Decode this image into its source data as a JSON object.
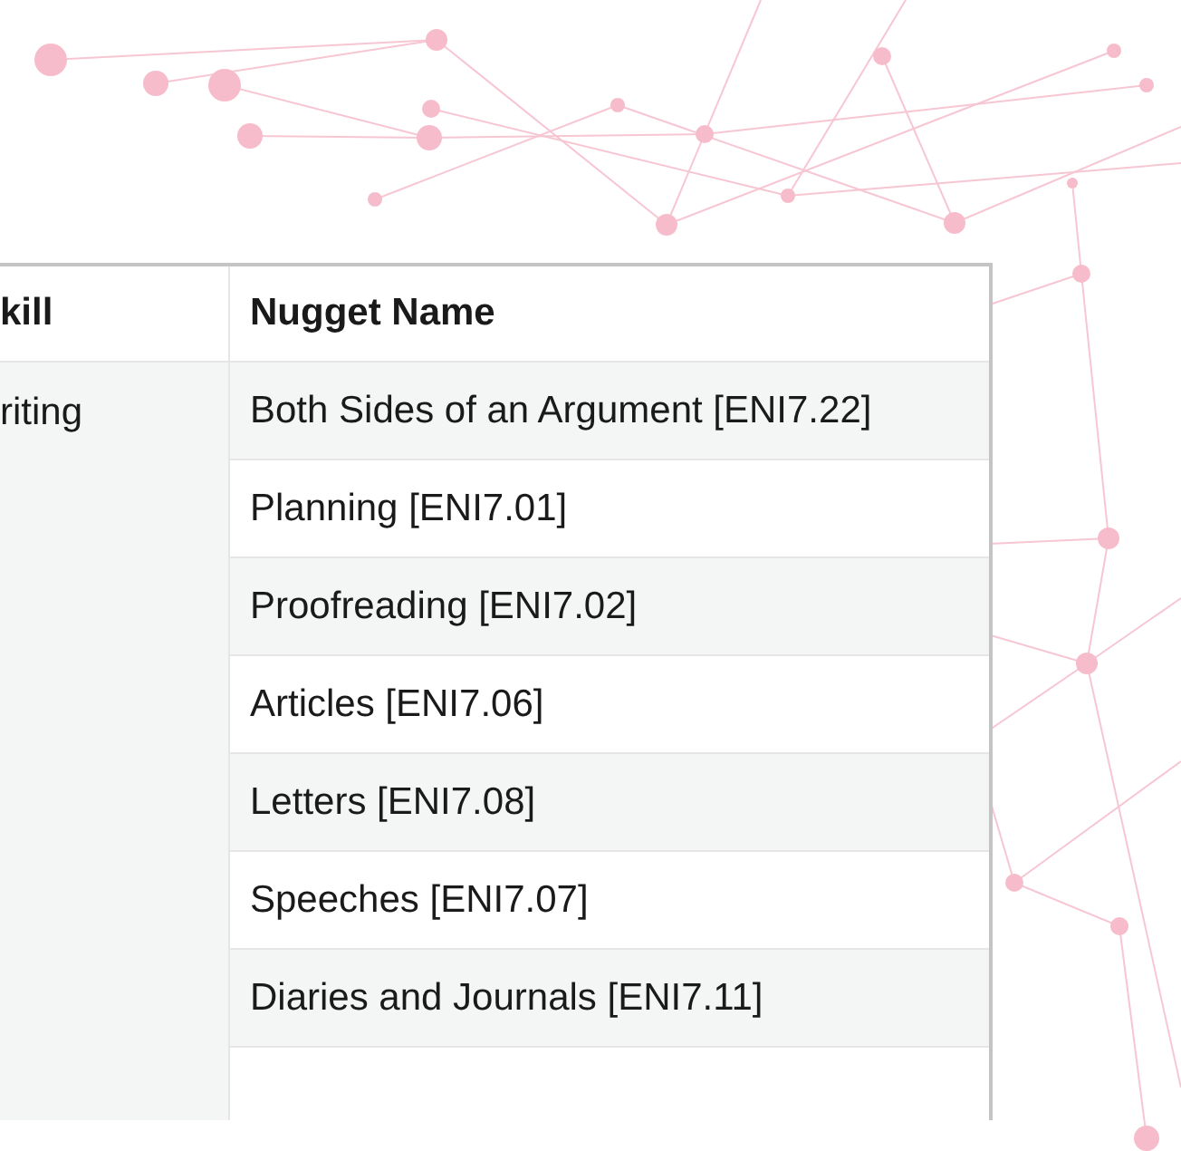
{
  "table": {
    "columns": [
      "kill",
      "Nugget Name"
    ],
    "skill": "riting",
    "rows": [
      "Both Sides of an Argument [ENI7.22]",
      "Planning [ENI7.01]",
      "Proofreading [ENI7.02]",
      "Articles [ENI7.06]",
      "Letters [ENI7.08]",
      "Speeches [ENI7.07]",
      "Diaries and Journals [ENI7.11]"
    ]
  }
}
